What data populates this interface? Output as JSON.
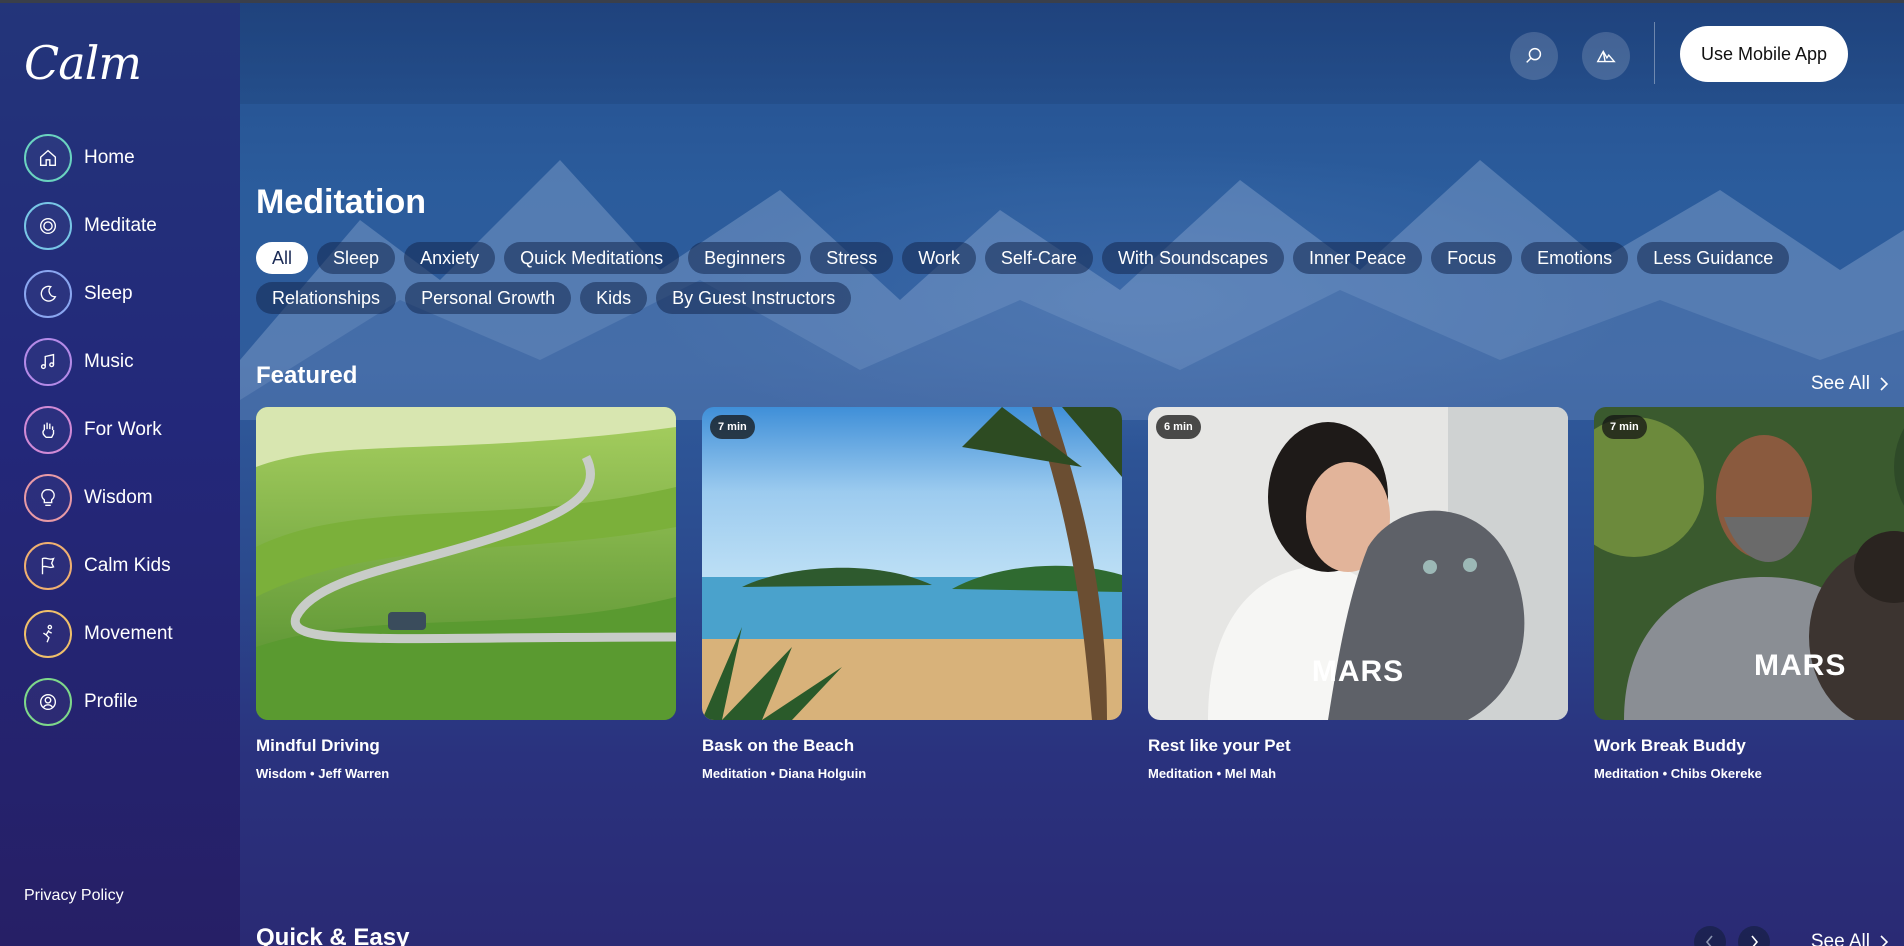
{
  "app": {
    "logo": "Calm"
  },
  "sidebar": {
    "items": [
      {
        "label": "Home",
        "icon": "home-icon",
        "color": "#6ad3c0"
      },
      {
        "label": "Meditate",
        "icon": "meditate-icon",
        "color": "#78c6e6"
      },
      {
        "label": "Sleep",
        "icon": "moon-icon",
        "color": "#8aa6f0"
      },
      {
        "label": "Music",
        "icon": "music-note-icon",
        "color": "#b48ae8"
      },
      {
        "label": "For Work",
        "icon": "hand-icon",
        "color": "#d08ad6"
      },
      {
        "label": "Wisdom",
        "icon": "lightbulb-icon",
        "color": "#e89aa6"
      },
      {
        "label": "Calm Kids",
        "icon": "flag-icon",
        "color": "#f0b070"
      },
      {
        "label": "Movement",
        "icon": "movement-icon",
        "color": "#f0c06a"
      },
      {
        "label": "Profile",
        "icon": "profile-icon",
        "color": "#7ed88a"
      }
    ],
    "privacy": "Privacy Policy"
  },
  "header": {
    "search_icon": "search-icon",
    "scenes_icon": "mountain-icon",
    "mobile_button": "Use Mobile App"
  },
  "page": {
    "title": "Meditation",
    "chips_row1": [
      "All",
      "Sleep",
      "Anxiety",
      "Quick Meditations",
      "Beginners",
      "Stress",
      "Work",
      "Self-Care",
      "With Soundscapes",
      "Inner Peace",
      "Focus",
      "Emotions",
      "Less Guidance"
    ],
    "chips_row2": [
      "Relationships",
      "Personal Growth",
      "Kids",
      "By Guest Instructors"
    ],
    "active_chip": "All"
  },
  "featured": {
    "title": "Featured",
    "see_all": "See All",
    "cards": [
      {
        "title": "Mindful Driving",
        "subtitle": "Wisdom • Jeff Warren",
        "duration": "",
        "brand": ""
      },
      {
        "title": "Bask on the Beach",
        "subtitle": "Meditation • Diana Holguin",
        "duration": "7 min",
        "brand": ""
      },
      {
        "title": "Rest like your Pet",
        "subtitle": "Meditation • Mel Mah",
        "duration": "6 min",
        "brand": "MARS"
      },
      {
        "title": "Work Break Buddy",
        "subtitle": "Meditation • Chibs Okereke",
        "duration": "7 min",
        "brand": "MARS"
      }
    ]
  },
  "quick": {
    "title": "Quick & Easy",
    "see_all": "See All"
  },
  "colors": {
    "accent": "#6ad3c0",
    "bg_top": "#244e8e",
    "bg_bottom": "#2a2a74"
  }
}
